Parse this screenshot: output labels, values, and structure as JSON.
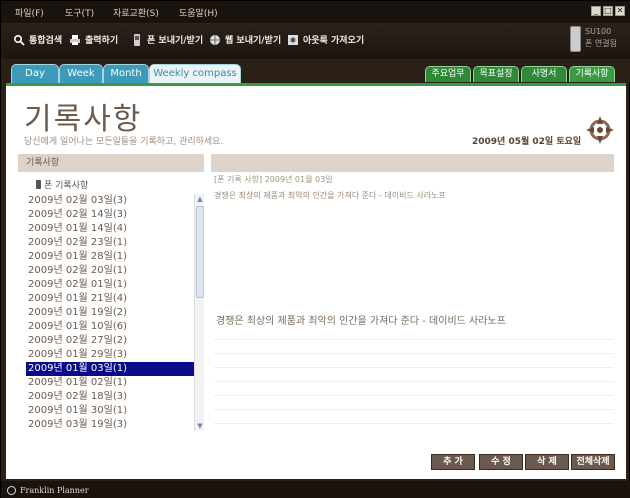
{
  "menu": [
    {
      "label": "파일(F)"
    },
    {
      "label": "도구(T)"
    },
    {
      "label": "자료교환(S)"
    },
    {
      "label": "도움말(H)"
    }
  ],
  "window_buttons": [
    "_",
    "□",
    "✕"
  ],
  "toolbar": {
    "search": "통합검색",
    "print": "출력하기",
    "phone_sync": "폰 보내기/받기",
    "web_sync": "웹 보내기/받기",
    "outlook": "아웃룩 가져오기"
  },
  "device": {
    "model": "SU100",
    "status": "폰 연결됨"
  },
  "view_tabs": [
    "Day",
    "Week",
    "Month",
    "Weekly compass"
  ],
  "right_tabs": [
    "주요업무",
    "목표설정",
    "사명서",
    "기록사항"
  ],
  "page": {
    "title": "기록사항",
    "subtitle": "당신에게 일어나는 모든일들을 기록하고, 관리하세요.",
    "date": "2009년 05월 02일 토요일"
  },
  "left_panel": {
    "header": "기록사항",
    "phone_label": "폰 기록사항"
  },
  "entries": [
    "2009년 02월 03일(3)",
    "2009년 02월 14일(3)",
    "2009년 01월 14일(4)",
    "2009년 02월 23일(1)",
    "2009년 01월 28일(1)",
    "2009년 02월 20일(1)",
    "2009년 02월 01일(1)",
    "2009년 01월 21일(4)",
    "2009년 01월 19일(2)",
    "2009년 01월 10일(6)",
    "2009년 02월 27일(2)",
    "2009년 01월 29일(3)",
    "2009년 01월 03일(1)",
    "2009년 01월 02일(1)",
    "2009년 02월 18일(3)",
    "2009년 01월 30일(1)",
    "2009년 03월 19일(3)"
  ],
  "selected_index": 12,
  "detail": {
    "breadcrumb": "[폰 기록 사항] 2009년 01월 03일",
    "quote_preview": "경쟁은 최상의 제품과 최악의 인간을 가져다 준다 - 데이비드 사라노프",
    "quote_body": "경쟁은 최상의 제품과 최악의 인간을 가져다 준다 - 데이비드 사라노프"
  },
  "buttons": {
    "add": "추 가",
    "edit": "수 정",
    "delete": "삭 제",
    "delete_all": "전체삭제"
  },
  "status_bar": "Franklin Planner",
  "colors": {
    "left_tab": "#3d9ab8",
    "right_tab": "#2f8a38",
    "selection": "#0b0b8a",
    "button": "#6b5a4d"
  }
}
